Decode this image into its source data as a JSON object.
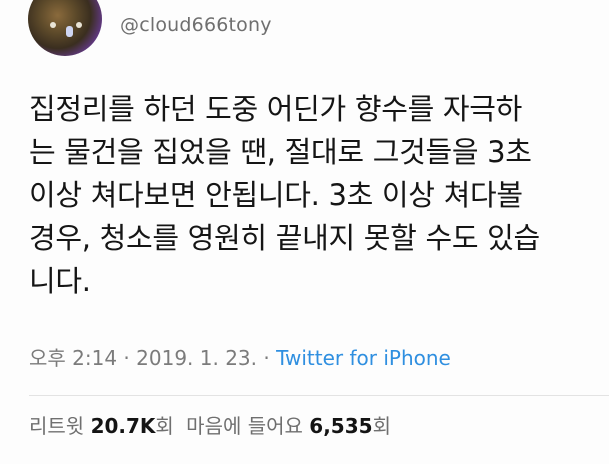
{
  "account": {
    "handle": "@cloud666tony"
  },
  "tweet": {
    "lines": [
      "집정리를 하던 도중 어딘가 향수를 자극하",
      "는 물건을 집었을 땐, 절대로 그것들을 3초",
      "이상 쳐다보면 안됩니다. 3초 이상 쳐다볼",
      "경우, 청소를 영원히 끝내지 못할 수도 있습",
      "니다."
    ]
  },
  "meta": {
    "time": "오후 2:14",
    "sep1": " · ",
    "date": "2019. 1. 23.",
    "sep2": " · ",
    "source": "Twitter for iPhone"
  },
  "stats": {
    "retweet_label": "리트윗",
    "retweet_count": "20.7K",
    "retweet_unit": "회",
    "like_label": "마음에 들어요",
    "like_count": "6,535",
    "like_unit": "회"
  },
  "colors": {
    "link": "#2f8fe0",
    "meta_text": "#7b7b7b",
    "divider": "#e3e3e3"
  }
}
